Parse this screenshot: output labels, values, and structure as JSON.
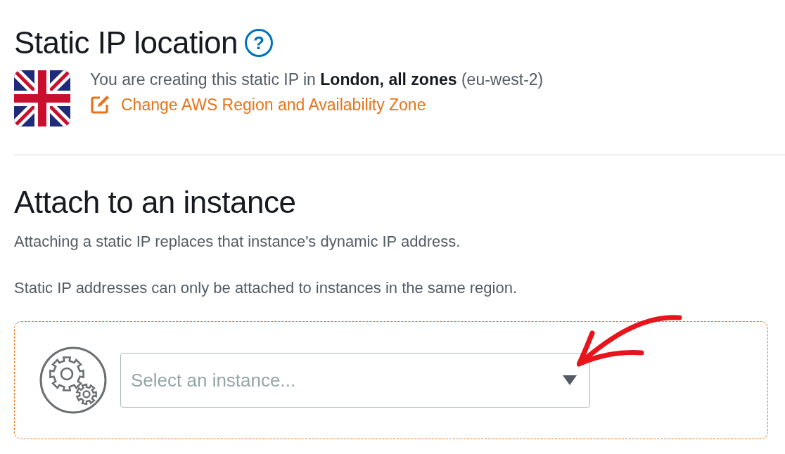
{
  "location": {
    "title": "Static IP location",
    "help": "?",
    "message": "You are creating this static IP in **London, all zones** (eu-west-2)",
    "change_link": "Change AWS Region and Availability Zone"
  },
  "attach": {
    "title": "Attach to an instance",
    "notes": [
      "Attaching a static IP replaces that instance's dynamic IP address.",
      "Static IP addresses can only be attached to instances in the same region."
    ],
    "instance_select": {
      "placeholder": "Select an instance..."
    }
  }
}
